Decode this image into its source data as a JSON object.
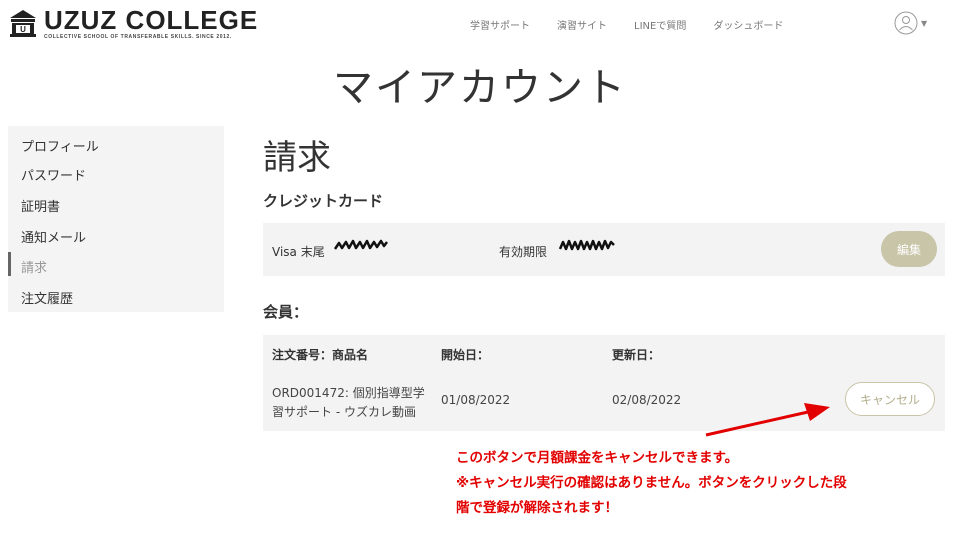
{
  "header": {
    "brand": "UZUZ COLLEGE",
    "tagline": "COLLECTIVE SCHOOL OF TRANSFERABLE SKILLS. SINCE 2012.",
    "nav": [
      "学習サポート",
      "演習サイト",
      "LINEで質問",
      "ダッシュボード"
    ]
  },
  "page_title": "マイアカウント",
  "sidebar": {
    "items": [
      {
        "label": "プロフィール"
      },
      {
        "label": "パスワード"
      },
      {
        "label": "証明書"
      },
      {
        "label": "通知メール"
      },
      {
        "label": "請求"
      },
      {
        "label": "注文履歴"
      }
    ],
    "active_index": 4
  },
  "billing": {
    "title": "請求",
    "credit_card_heading": "クレジットカード",
    "card_label": "Visa 末尾",
    "expiry_label": "有効期限",
    "edit_label": "編集"
  },
  "membership": {
    "heading": "会員：",
    "columns": [
      "注文番号：商品名",
      "開始日：",
      "更新日："
    ],
    "row": {
      "order_line1": "ORD001472: 個別指導型学",
      "order_line2": "習サポート - ウズカレ動画",
      "start_date": "01/08/2022",
      "renew_date": "02/08/2022"
    },
    "cancel_label": "キャンセル"
  },
  "annotation": {
    "line1": "このボタンで月額課金をキャンセルできます。",
    "line2": "※キャンセル実行の確認はありません。ボタンをクリックした段",
    "line3": "階で登録が解除されます！",
    "color": "#e20000"
  },
  "colors": {
    "accent": "#c9c5a8",
    "panel_bg": "#f3f3f3"
  }
}
